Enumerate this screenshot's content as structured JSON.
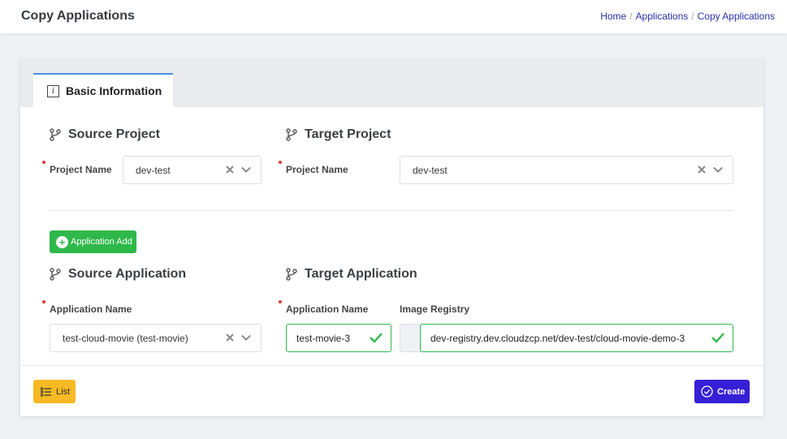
{
  "header": {
    "title": "Copy Applications",
    "breadcrumb": [
      "Home",
      "Applications",
      "Copy Applications"
    ]
  },
  "tabs": [
    {
      "label": "Basic Information",
      "icon": "info-icon"
    }
  ],
  "source_project": {
    "title": "Source Project",
    "field_label": "Project Name",
    "value": "dev-test"
  },
  "target_project": {
    "title": "Target Project",
    "field_label": "Project Name",
    "value": "dev-test"
  },
  "add_button": {
    "label": "Application Add",
    "icon": "plus-circle-icon"
  },
  "source_application": {
    "title": "Source Application",
    "field_label": "Application Name",
    "value": "test-cloud-movie (test-movie)"
  },
  "target_application": {
    "title": "Target Application",
    "name_label": "Application Name",
    "name_value": "test-movie-3",
    "registry_label": "Image Registry",
    "registry_value": "dev-registry.dev.cloudzcp.net/dev-test/cloud-movie-demo-3"
  },
  "footer": {
    "list_label": "List",
    "create_label": "Create"
  },
  "colors": {
    "accent_green": "#2eb84a",
    "primary": "#3520d6",
    "warning": "#f7b924",
    "required": "#e03a3a",
    "link": "#2a2fa8"
  }
}
